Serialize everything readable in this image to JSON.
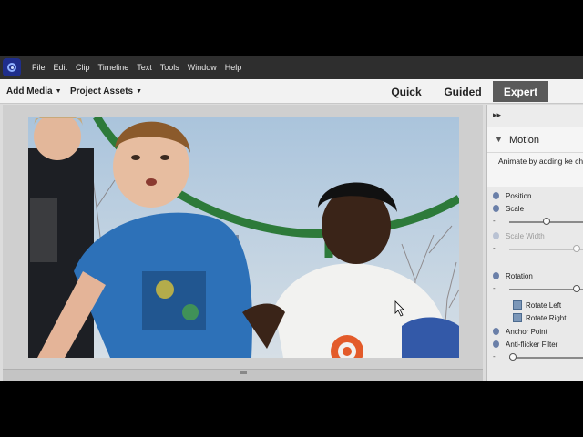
{
  "menubar": {
    "items": [
      "File",
      "Edit",
      "Clip",
      "Timeline",
      "Text",
      "Tools",
      "Window",
      "Help"
    ]
  },
  "modebar": {
    "add_media": "Add Media",
    "project_assets": "Project Assets",
    "modes": [
      "Quick",
      "Guided",
      "Expert"
    ],
    "active_mode": "Expert"
  },
  "panel": {
    "section_title": "Motion",
    "description": "Animate by adding ke changing",
    "properties": {
      "position": "Position",
      "scale": "Scale",
      "scale_width": "Scale Width",
      "rotation": "Rotation",
      "rotate_left": "Rotate Left",
      "rotate_right": "Rotate Right",
      "anchor_point": "Anchor Point",
      "anti_flicker": "Anti-flicker Filter"
    },
    "slider_levels": {
      "scale": 0.5,
      "scale_width": 0.95,
      "rotation": 0.95,
      "anti_flicker": 0.0
    },
    "slider_minus": "-"
  },
  "colors": {
    "menubar_bg": "#2e2e2e",
    "active_mode_bg": "#5a5a5a",
    "logo_bg": "#1f2e8c"
  }
}
